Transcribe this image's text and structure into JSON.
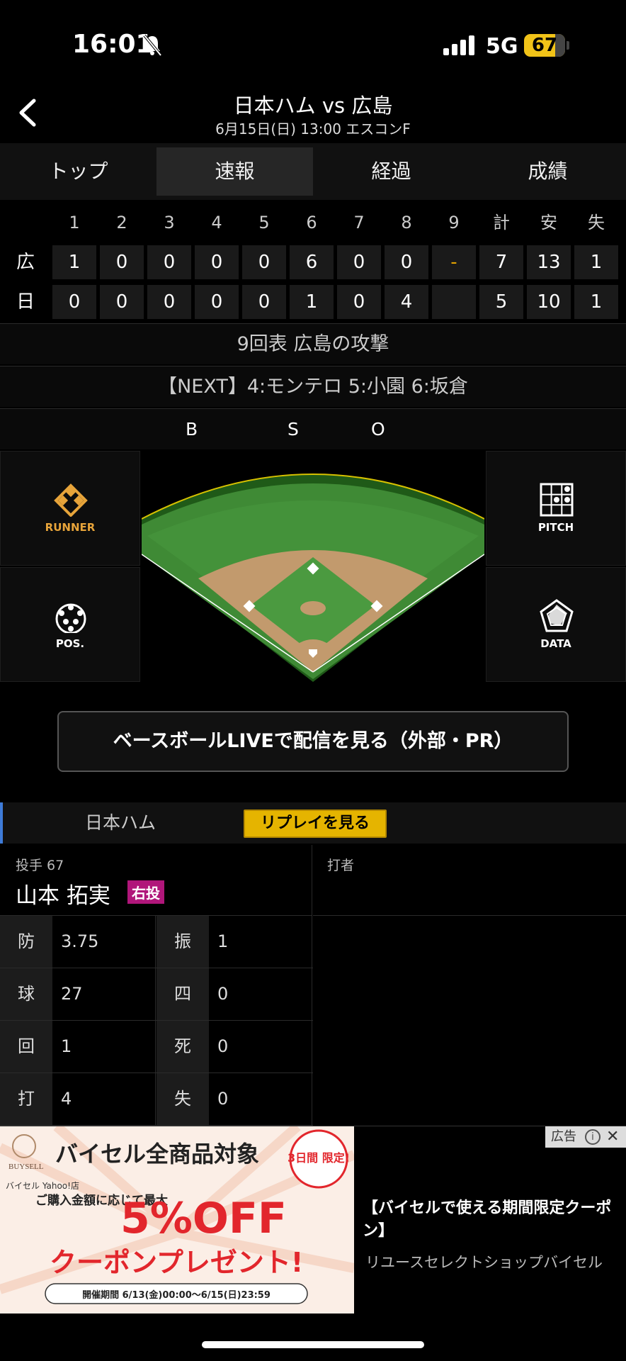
{
  "status": {
    "time": "16:01",
    "network": "5G",
    "battery": "67"
  },
  "header": {
    "title": "日本ハム vs 広島",
    "subtitle": "6月15日(日) 13:00 エスコンF"
  },
  "tabs": [
    {
      "label": "トップ"
    },
    {
      "label": "速報"
    },
    {
      "label": "経過"
    },
    {
      "label": "成績"
    }
  ],
  "scoreboard": {
    "headers": [
      "1",
      "2",
      "3",
      "4",
      "5",
      "6",
      "7",
      "8",
      "9",
      "計",
      "安",
      "失"
    ],
    "rows": [
      {
        "team": "広",
        "cells": [
          "1",
          "0",
          "0",
          "0",
          "0",
          "6",
          "0",
          "0",
          "-",
          "7",
          "13",
          "1"
        ]
      },
      {
        "team": "日",
        "cells": [
          "0",
          "0",
          "0",
          "0",
          "0",
          "1",
          "0",
          "4",
          "",
          "5",
          "10",
          "1"
        ]
      }
    ]
  },
  "inning_status": "9回表 広島の攻撃",
  "next_batters": "【NEXT】4:モンテロ 5:小園 6:坂倉",
  "count": {
    "b": "B",
    "s": "S",
    "o": "O"
  },
  "side_buttons": {
    "runner": "RUNNER",
    "pitch": "PITCH",
    "pos": "POS.",
    "data": "DATA"
  },
  "live_button": "ベースボールLIVEで配信を見る（外部・PR）",
  "team_bar": {
    "team": "日本ハム",
    "replay": "リプレイを見る"
  },
  "pitcher": {
    "label": "投手 67",
    "name": "山本 拓実",
    "throws": "右投",
    "stats": [
      {
        "k1": "防",
        "v1": "3.75",
        "k2": "振",
        "v2": "1"
      },
      {
        "k1": "球",
        "v1": "27",
        "k2": "四",
        "v2": "0"
      },
      {
        "k1": "回",
        "v1": "1",
        "k2": "死",
        "v2": "0"
      },
      {
        "k1": "打",
        "v1": "4",
        "k2": "失",
        "v2": "0"
      }
    ]
  },
  "batter": {
    "label": "打者"
  },
  "ad": {
    "mark": "広告",
    "banner_brand": "BUYSELL",
    "banner_store": "バイセル Yahoo!店",
    "banner_headline": "バイセル全商品対象",
    "banner_days": "3日間 限定!",
    "banner_condition": "ご購入金額に応じて最大",
    "banner_offer": "5%OFF",
    "banner_coupon": "クーポンプレゼント!",
    "banner_period": "開催期間 6/13(金)00:00～6/15(日)23:59",
    "title": "【バイセルで使える期間限定クーポン】",
    "description": "リユースセレクトショップバイセル"
  },
  "colors": {
    "accent": "#e5b400",
    "field_green": "#3f8a35",
    "dirt": "#c29a6d",
    "team_bar": "#3e7bd8",
    "throws_badge": "#b0167a"
  }
}
